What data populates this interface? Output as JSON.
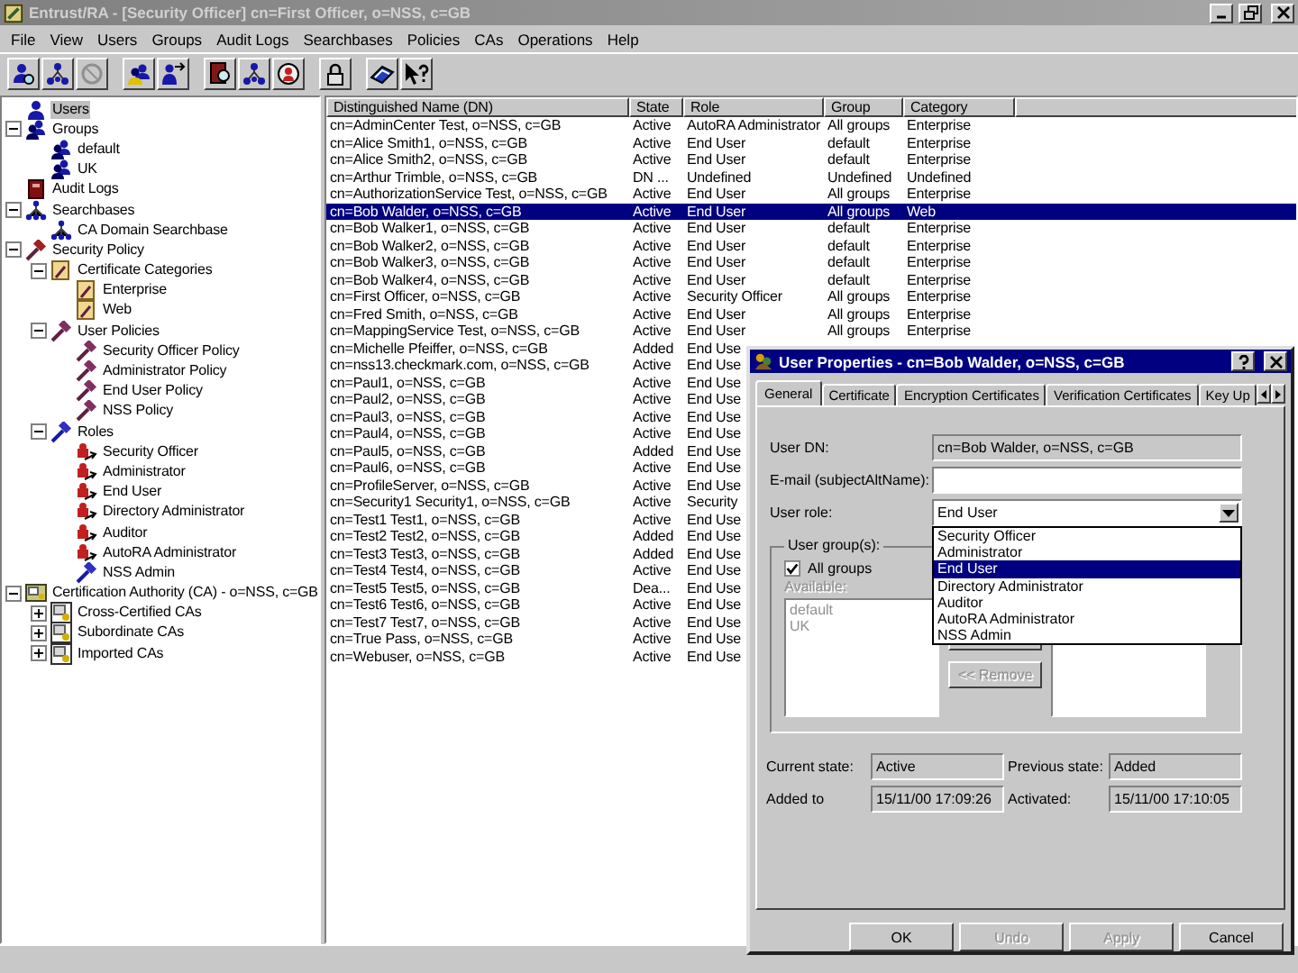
{
  "window": {
    "title": "Entrust/RA - [Security Officer] cn=First Officer, o=NSS, c=GB"
  },
  "menu": [
    "File",
    "View",
    "Users",
    "Groups",
    "Audit Logs",
    "Searchbases",
    "Policies",
    "CAs",
    "Operations",
    "Help"
  ],
  "tree": [
    {
      "label": "Users",
      "kind": "users",
      "selected": true
    },
    {
      "label": "Groups",
      "kind": "group",
      "selected": false,
      "expanded": true,
      "children": [
        {
          "label": "default",
          "kind": "group",
          "selected": false
        },
        {
          "label": "UK",
          "kind": "group",
          "selected": false
        }
      ]
    },
    {
      "label": "Audit Logs",
      "kind": "audit",
      "selected": false
    },
    {
      "label": "Searchbases",
      "kind": "searchbase",
      "selected": false,
      "expanded": true,
      "children": [
        {
          "label": "CA Domain Searchbase",
          "kind": "searchbase",
          "selected": false
        }
      ]
    },
    {
      "label": "Security Policy",
      "kind": "policy",
      "selected": false,
      "expanded": true,
      "children": [
        {
          "label": "Certificate Categories",
          "kind": "category",
          "selected": false,
          "expanded": true,
          "children": [
            {
              "label": "Enterprise",
              "kind": "category",
              "selected": false
            },
            {
              "label": "Web",
              "kind": "category",
              "selected": false
            }
          ]
        },
        {
          "label": "User Policies",
          "kind": "user-policy",
          "selected": false,
          "expanded": true,
          "children": [
            {
              "label": "Security Officer Policy",
              "kind": "user-policy",
              "selected": false
            },
            {
              "label": "Administrator Policy",
              "kind": "user-policy",
              "selected": false
            },
            {
              "label": "End User Policy",
              "kind": "user-policy",
              "selected": false
            },
            {
              "label": "NSS Policy",
              "kind": "user-policy",
              "selected": false
            }
          ]
        },
        {
          "label": "Roles",
          "kind": "roles",
          "selected": false,
          "expanded": true,
          "children": [
            {
              "label": "Security Officer",
              "kind": "role",
              "selected": false
            },
            {
              "label": "Administrator",
              "kind": "role",
              "selected": false
            },
            {
              "label": "End User",
              "kind": "role",
              "selected": false
            },
            {
              "label": "Directory Administrator",
              "kind": "role",
              "selected": false
            },
            {
              "label": "Auditor",
              "kind": "role",
              "selected": false
            },
            {
              "label": "AutoRA Administrator",
              "kind": "role",
              "selected": false
            },
            {
              "label": "NSS Admin",
              "kind": "roles",
              "selected": false
            }
          ]
        }
      ]
    },
    {
      "label": "Certification Authority (CA) - o=NSS, c=GB",
      "kind": "ca",
      "selected": false,
      "expanded": true,
      "children": [
        {
          "label": "Cross-Certified CAs",
          "kind": "ca-link",
          "selected": false,
          "expanded": false
        },
        {
          "label": "Subordinate CAs",
          "kind": "ca-link",
          "selected": false,
          "expanded": false
        },
        {
          "label": "Imported CAs",
          "kind": "ca-link",
          "selected": false,
          "expanded": false
        }
      ]
    }
  ],
  "table": {
    "columns": [
      "Distinguished Name (DN)",
      "State",
      "Role",
      "Group",
      "Category"
    ],
    "rows": [
      {
        "dn": "cn=AdminCenter Test, o=NSS, c=GB",
        "state": "Active",
        "role": "AutoRA Administrator",
        "group": "All groups",
        "category": "Enterprise",
        "selected": false
      },
      {
        "dn": "cn=Alice Smith1, o=NSS, c=GB",
        "state": "Active",
        "role": "End User",
        "group": "default",
        "category": "Enterprise",
        "selected": false
      },
      {
        "dn": "cn=Alice Smith2, o=NSS, c=GB",
        "state": "Active",
        "role": "End User",
        "group": "default",
        "category": "Enterprise",
        "selected": false
      },
      {
        "dn": "cn=Arthur Trimble, o=NSS, c=GB",
        "state": "DN ...",
        "role": "Undefined",
        "group": "Undefined",
        "category": "Undefined",
        "selected": false
      },
      {
        "dn": "cn=AuthorizationService Test, o=NSS, c=GB",
        "state": "Active",
        "role": "End User",
        "group": "All groups",
        "category": "Enterprise",
        "selected": false
      },
      {
        "dn": "cn=Bob Walder, o=NSS, c=GB",
        "state": "Active",
        "role": "End User",
        "group": "All groups",
        "category": "Web",
        "selected": true
      },
      {
        "dn": "cn=Bob Walker1, o=NSS, c=GB",
        "state": "Active",
        "role": "End User",
        "group": "default",
        "category": "Enterprise",
        "selected": false
      },
      {
        "dn": "cn=Bob Walker2, o=NSS, c=GB",
        "state": "Active",
        "role": "End User",
        "group": "default",
        "category": "Enterprise",
        "selected": false
      },
      {
        "dn": "cn=Bob Walker3, o=NSS, c=GB",
        "state": "Active",
        "role": "End User",
        "group": "default",
        "category": "Enterprise",
        "selected": false
      },
      {
        "dn": "cn=Bob Walker4, o=NSS, c=GB",
        "state": "Active",
        "role": "End User",
        "group": "default",
        "category": "Enterprise",
        "selected": false
      },
      {
        "dn": "cn=First Officer, o=NSS, c=GB",
        "state": "Active",
        "role": "Security Officer",
        "group": "All groups",
        "category": "Enterprise",
        "selected": false
      },
      {
        "dn": "cn=Fred Smith, o=NSS, c=GB",
        "state": "Active",
        "role": "End User",
        "group": "All groups",
        "category": "Enterprise",
        "selected": false
      },
      {
        "dn": "cn=MappingService Test, o=NSS, c=GB",
        "state": "Active",
        "role": "End User",
        "group": "All groups",
        "category": "Enterprise",
        "selected": false
      },
      {
        "dn": "cn=Michelle Pfeiffer, o=NSS, c=GB",
        "state": "Added",
        "role": "End Use",
        "selected": false
      },
      {
        "dn": "cn=nss13.checkmark.com, o=NSS, c=GB",
        "state": "Active",
        "role": "End Use",
        "selected": false
      },
      {
        "dn": "cn=Paul1, o=NSS, c=GB",
        "state": "Active",
        "role": "End Use",
        "selected": false
      },
      {
        "dn": "cn=Paul2, o=NSS, c=GB",
        "state": "Active",
        "role": "End Use",
        "selected": false
      },
      {
        "dn": "cn=Paul3, o=NSS, c=GB",
        "state": "Active",
        "role": "End Use",
        "selected": false
      },
      {
        "dn": "cn=Paul4, o=NSS, c=GB",
        "state": "Active",
        "role": "End Use",
        "selected": false
      },
      {
        "dn": "cn=Paul5, o=NSS, c=GB",
        "state": "Added",
        "role": "End Use",
        "selected": false
      },
      {
        "dn": "cn=Paul6, o=NSS, c=GB",
        "state": "Active",
        "role": "End Use",
        "selected": false
      },
      {
        "dn": "cn=ProfileServer, o=NSS, c=GB",
        "state": "Active",
        "role": "End Use",
        "selected": false
      },
      {
        "dn": "cn=Security1 Security1, o=NSS, c=GB",
        "state": "Active",
        "role": "Security",
        "selected": false
      },
      {
        "dn": "cn=Test1 Test1, o=NSS, c=GB",
        "state": "Active",
        "role": "End Use",
        "selected": false
      },
      {
        "dn": "cn=Test2 Test2, o=NSS, c=GB",
        "state": "Added",
        "role": "End Use",
        "selected": false
      },
      {
        "dn": "cn=Test3 Test3, o=NSS, c=GB",
        "state": "Added",
        "role": "End Use",
        "selected": false
      },
      {
        "dn": "cn=Test4 Test4, o=NSS, c=GB",
        "state": "Active",
        "role": "End Use",
        "selected": false
      },
      {
        "dn": "cn=Test5 Test5, o=NSS, c=GB",
        "state": "Dea...",
        "role": "End Use",
        "selected": false
      },
      {
        "dn": "cn=Test6 Test6, o=NSS, c=GB",
        "state": "Active",
        "role": "End Use",
        "selected": false
      },
      {
        "dn": "cn=Test7 Test7, o=NSS, c=GB",
        "state": "Active",
        "role": "End Use",
        "selected": false
      },
      {
        "dn": "cn=True Pass, o=NSS, c=GB",
        "state": "Active",
        "role": "End Use",
        "selected": false
      },
      {
        "dn": "cn=Webuser, o=NSS, c=GB",
        "state": "Active",
        "role": "End Use",
        "selected": false
      }
    ]
  },
  "dialog": {
    "title": "User Properties - cn=Bob Walder, o=NSS, c=GB",
    "tabs": [
      {
        "label": "General",
        "selected": true
      },
      {
        "label": "Certificate",
        "selected": false
      },
      {
        "label": "Encryption Certificates",
        "selected": false
      },
      {
        "label": "Verification Certificates",
        "selected": false
      },
      {
        "label": "Key Up",
        "selected": false
      }
    ],
    "user_dn": {
      "label": "User DN:",
      "value": "cn=Bob Walder, o=NSS, c=GB"
    },
    "email": {
      "label": "E-mail (subjectAltName):"
    },
    "role": {
      "label": "User role:",
      "value": "End User",
      "expanded": true,
      "options": [
        {
          "label": "Security Officer",
          "selected": false
        },
        {
          "label": "Administrator",
          "selected": false
        },
        {
          "label": "End User",
          "selected": true
        },
        {
          "label": "Directory Administrator",
          "selected": false
        },
        {
          "label": "Auditor",
          "selected": false
        },
        {
          "label": "AutoRA Administrator",
          "selected": false
        },
        {
          "label": "NSS Admin",
          "selected": false
        }
      ]
    },
    "groups": {
      "title": "User group(s):",
      "all_groups": {
        "label": "All groups",
        "checked": true
      },
      "available": {
        "label": "Available:",
        "disabled": true,
        "items": [
          "default",
          "UK"
        ]
      },
      "remove": {
        "label": "<< Remove",
        "disabled": true
      }
    },
    "states": [
      {
        "label": "Current state:",
        "value": "Active"
      },
      {
        "label": "Previous state:",
        "value": "Added"
      },
      {
        "label": "Added to",
        "value": "15/11/00 17:09:26"
      },
      {
        "label": "Activated:",
        "value": "15/11/00 17:10:05"
      }
    ],
    "buttons": [
      {
        "label": "OK",
        "disabled": false
      },
      {
        "label": "Undo",
        "disabled": true
      },
      {
        "label": "Apply",
        "disabled": true
      },
      {
        "label": "Cancel",
        "disabled": false
      }
    ]
  }
}
